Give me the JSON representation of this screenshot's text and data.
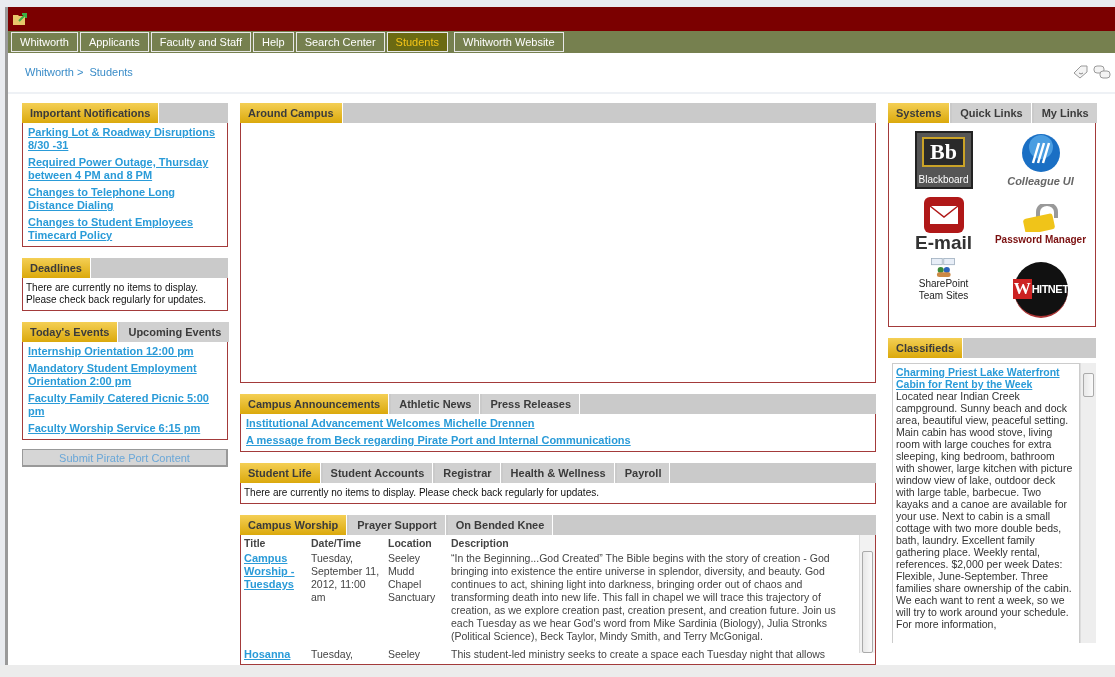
{
  "nav": [
    {
      "label": "Whitworth",
      "selected": false
    },
    {
      "label": "Applicants",
      "selected": false
    },
    {
      "label": "Faculty and Staff",
      "selected": false
    },
    {
      "label": "Help",
      "selected": false
    },
    {
      "label": "Search Center",
      "selected": false
    },
    {
      "label": "Students",
      "selected": true
    },
    {
      "label": "Whitworth Website",
      "selected": false
    }
  ],
  "breadcrumb": {
    "parent": "Whitworth >",
    "current": "Students"
  },
  "left_column": [
    {
      "kind": "links",
      "tabs": [
        {
          "label": "Important Notifications",
          "selected": true
        }
      ],
      "links": [
        "Parking Lot & Roadway Disruptions 8/30 -31",
        "Required Power Outage, Thursday between 4 PM and 8 PM",
        "Changes to Telephone Long Distance Dialing",
        "Changes to Student Employees Timecard Policy"
      ]
    },
    {
      "kind": "message",
      "tabs": [
        {
          "label": "Deadlines",
          "selected": true
        }
      ],
      "message": "There are currently no items to display. Please check back regularly for updates."
    },
    {
      "kind": "links",
      "tabs": [
        {
          "label": "Today's Events",
          "selected": true
        },
        {
          "label": "Upcoming Events",
          "selected": false
        }
      ],
      "links": [
        "Internship Orientation 12:00 pm",
        "Mandatory Student Employment Orientation 2:00 pm",
        "Faculty Family Catered Picnic 5:00 pm",
        "Faculty Worship Service 6:15 pm"
      ]
    }
  ],
  "submit_button": "Submit Pirate Port Content",
  "middle_column": [
    {
      "kind": "empty",
      "tabs": [
        {
          "label": "Around Campus",
          "selected": true
        }
      ]
    },
    {
      "kind": "links",
      "tabs": [
        {
          "label": "Campus Announcements",
          "selected": true
        },
        {
          "label": "Athletic News",
          "selected": false
        },
        {
          "label": "Press Releases",
          "selected": false
        }
      ],
      "links": [
        "Institutional Advancement Welcomes Michelle Drennen",
        "A message from Beck regarding Pirate Port and Internal Communications"
      ]
    },
    {
      "kind": "message",
      "tabs": [
        {
          "label": "Student Life",
          "selected": true
        },
        {
          "label": "Student Accounts",
          "selected": false
        },
        {
          "label": "Registrar",
          "selected": false
        },
        {
          "label": "Health & Wellness",
          "selected": false
        },
        {
          "label": "Payroll",
          "selected": false
        }
      ],
      "message": "There are currently no items to display. Please check back regularly for updates."
    },
    {
      "kind": "table",
      "tabs": [
        {
          "label": "Campus Worship",
          "selected": true
        },
        {
          "label": "Prayer Support",
          "selected": false
        },
        {
          "label": "On Bended Knee",
          "selected": false
        }
      ],
      "columns": [
        "Title",
        "Date/Time",
        "Location",
        "Description"
      ],
      "rows": [
        [
          "Campus Worship - Tuesdays",
          "Tuesday, September 11, 2012, 11:00 am",
          "Seeley Mudd Chapel Sanctuary",
          "“In the Beginning...God Created” The Bible begins with the story of creation - God bringing into existence the entire universe in splendor, diversity, and beauty. God continues to act, shining light into darkness, bringing order out of chaos and transforming death into new life. This fall in chapel we will trace this trajectory of creation, as we explore creation past, creation present, and creation future. Join us each Tuesday as we hear God's word from Mike Sardinia (Biology), Julia Stronks (Political Science), Beck Taylor, Mindy Smith, and Terry McGonigal."
        ],
        [
          "Hosanna",
          "Tuesday,",
          "Seeley",
          "This student-led ministry seeks to create a space each Tuesday night that allows"
        ]
      ]
    }
  ],
  "right_column": [
    {
      "kind": "systems",
      "tabs": [
        {
          "label": "Systems",
          "selected": true
        },
        {
          "label": "Quick Links",
          "selected": false
        },
        {
          "label": "My Links",
          "selected": false
        }
      ],
      "systems": [
        {
          "kind": "blackboard",
          "logo_text": "Bb",
          "label": "Blackboard"
        },
        {
          "kind": "colleague",
          "label": "Colleague UI"
        },
        {
          "kind": "email",
          "label": "E-mail"
        },
        {
          "kind": "password",
          "label": "Password Manager"
        },
        {
          "kind": "sharepoint",
          "label": "SharePoint",
          "label_2": "Team Sites"
        },
        {
          "kind": "whitnet",
          "logo_text": "W",
          "label": "HITNET"
        }
      ]
    },
    {
      "kind": "classified",
      "tabs": [
        {
          "label": "Classifieds",
          "selected": true
        }
      ],
      "title": "Charming Priest Lake Waterfront Cabin for Rent by the Week",
      "body": "Located near Indian Creek campground. Sunny beach and dock area, beautiful view, peaceful setting. Main cabin has wood stove, living room with large couches for extra sleeping, king bedroom, bathroom with shower, large kitchen with picture window view of lake, outdoor deck with large table, barbecue. Two kayaks and a canoe are available for your use. Next to cabin is a small cottage with two more double beds, bath, laundry. Excellent family gathering place. Weekly rental, references. $2,000 per week Dates: Flexible, June-September. Three families share ownership of the cabin. We each want to rent a week, so we will try to work around your schedule. For more information,"
    }
  ]
}
